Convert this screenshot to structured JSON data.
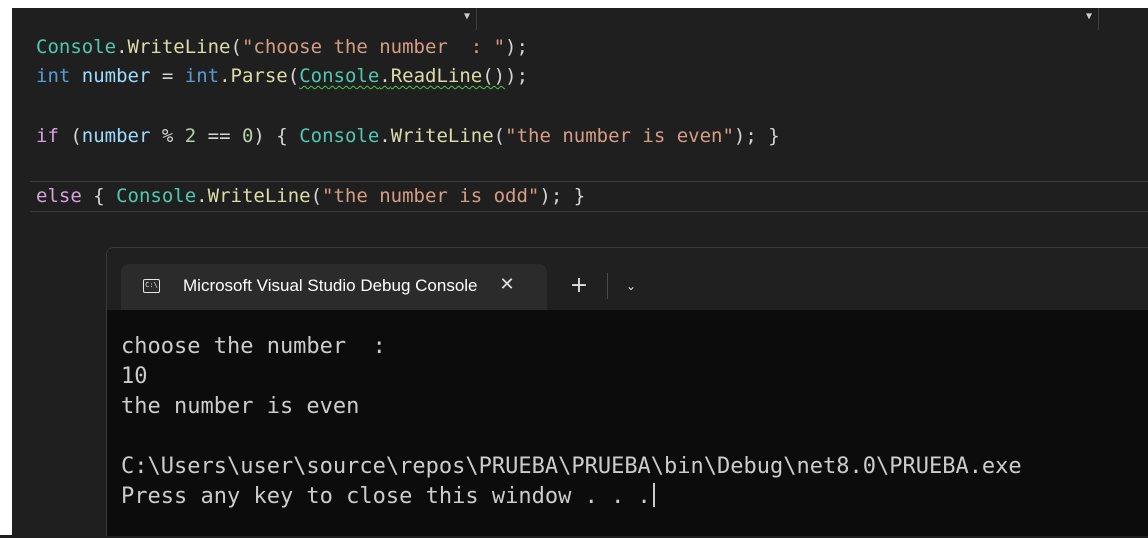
{
  "editor": {
    "lines": {
      "l1": {
        "cls": "Console",
        "dot": ".",
        "mth": "WriteLine",
        "open": "(",
        "str": "\"choose the number  : \"",
        "close": ");"
      },
      "l2": {
        "kw1": "int",
        "var": "number",
        "eq": " = ",
        "kw2": "int",
        "dot1": ".",
        "mth1": "Parse",
        "open1": "(",
        "cls": "Console",
        "dot2": ".",
        "mth2": "ReadLine",
        "paren": "()",
        "close": ");"
      },
      "l4": {
        "ctl": "if",
        "open": " (",
        "var": "number",
        "op1": " % ",
        "num1": "2",
        "op2": " == ",
        "num2": "0",
        "mid": ") { ",
        "cls": "Console",
        "dot": ".",
        "mth": "WriteLine",
        "open2": "(",
        "str": "\"the number is even\"",
        "close": "); }"
      },
      "l6": {
        "ctl": "else",
        "open": " { ",
        "cls": "Console",
        "dot": ".",
        "mth": "WriteLine",
        "open2": "(",
        "str": "\"the number is odd\"",
        "close": "); }"
      }
    }
  },
  "terminal": {
    "tab_title": "Microsoft Visual Studio Debug Console",
    "tab_icon_text": "C:\\",
    "close_glyph": "✕",
    "new_tab_glyph": "+",
    "dropdown_glyph": "⌄",
    "output": [
      "choose the number  :",
      "10",
      "the number is even",
      "",
      "C:\\Users\\user\\source\\repos\\PRUEBA\\PRUEBA\\bin\\Debug\\net8.0\\PRUEBA.exe",
      "Press any key to close this window . . ."
    ]
  },
  "colors": {
    "editor_bg": "#1f1f1f",
    "keyword": "#569cd6",
    "control": "#d8a0df",
    "class": "#4ec9b0",
    "method": "#dcdcaa",
    "string": "#d69d85",
    "number": "#b5cea8",
    "variable": "#9cdcfe",
    "terminal_bg": "#0c0c0c"
  }
}
